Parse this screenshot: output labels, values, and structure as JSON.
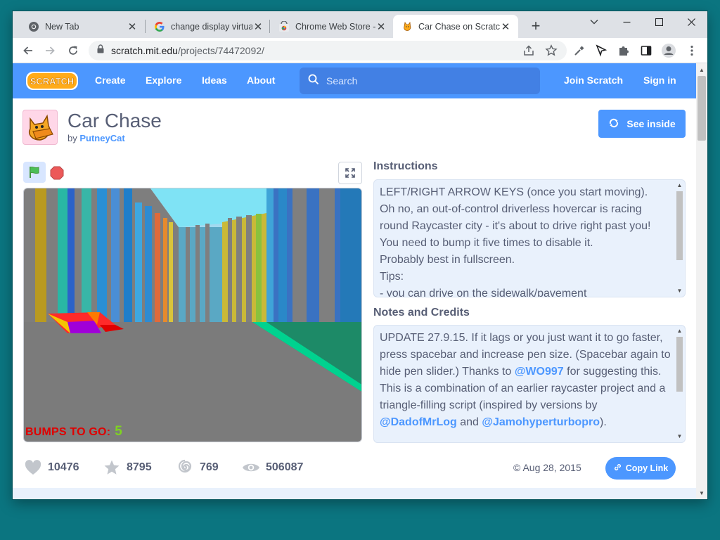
{
  "browser": {
    "tabs": [
      {
        "title": "New Tab",
        "favicon": "chrome-icon"
      },
      {
        "title": "change display virtua",
        "favicon": "google-icon"
      },
      {
        "title": "Chrome Web Store -",
        "favicon": "webstore-icon"
      },
      {
        "title": "Car Chase on Scratch",
        "favicon": "scratch-cat-icon",
        "active": true
      }
    ],
    "new_tab_label": "+",
    "url_host": "scratch.mit.edu",
    "url_path": "/projects/74472092/"
  },
  "scratch_nav": {
    "logo_text": "SCRATCH",
    "links": [
      "Create",
      "Explore",
      "Ideas",
      "About"
    ],
    "search_placeholder": "Search",
    "join": "Join Scratch",
    "signin": "Sign in"
  },
  "project": {
    "title": "Car Chase",
    "by_prefix": "by",
    "author": "PutneyCat",
    "see_inside": "See inside",
    "stage": {
      "bumps_label": "BUMPS TO GO:",
      "bumps_value": "5"
    },
    "instructions_title": "Instructions",
    "instructions": [
      "LEFT/RIGHT ARROW KEYS (once you start moving).",
      "Oh no, an out-of-control driverless hovercar is racing round Raycaster city - it's about to drive right past you!",
      "You need to bump it five times to disable it.",
      "Probably best in fullscreen.",
      "Tips:",
      "- you can drive on the sidewalk/pavement"
    ],
    "notes_title": "Notes and Credits",
    "notes_line1_a": "UPDATE 27.9.15. If it lags or you just want it to go faster, press spacebar and increase pen size. (Spacebar again to hide pen slider.) Thanks to ",
    "notes_mention1": "@WO997",
    "notes_line1_b": " for suggesting this.",
    "notes_line2_a": "This is a combination of an earlier raycaster project and a triangle-filling script (inspired by versions by ",
    "notes_mention2": "@DadofMrLog",
    "notes_line2_mid": " and ",
    "notes_mention3": "@Jamohyperturbopro",
    "notes_line2_b": ").",
    "stats": {
      "loves": "10476",
      "favorites": "8795",
      "remixes": "769",
      "views": "506087"
    },
    "date": "Aug 28, 2015",
    "copy_link": "Copy Link"
  },
  "colors": {
    "scratch_blue": "#4c97ff",
    "text_gray": "#575e75",
    "desktop": "#0b7580"
  }
}
